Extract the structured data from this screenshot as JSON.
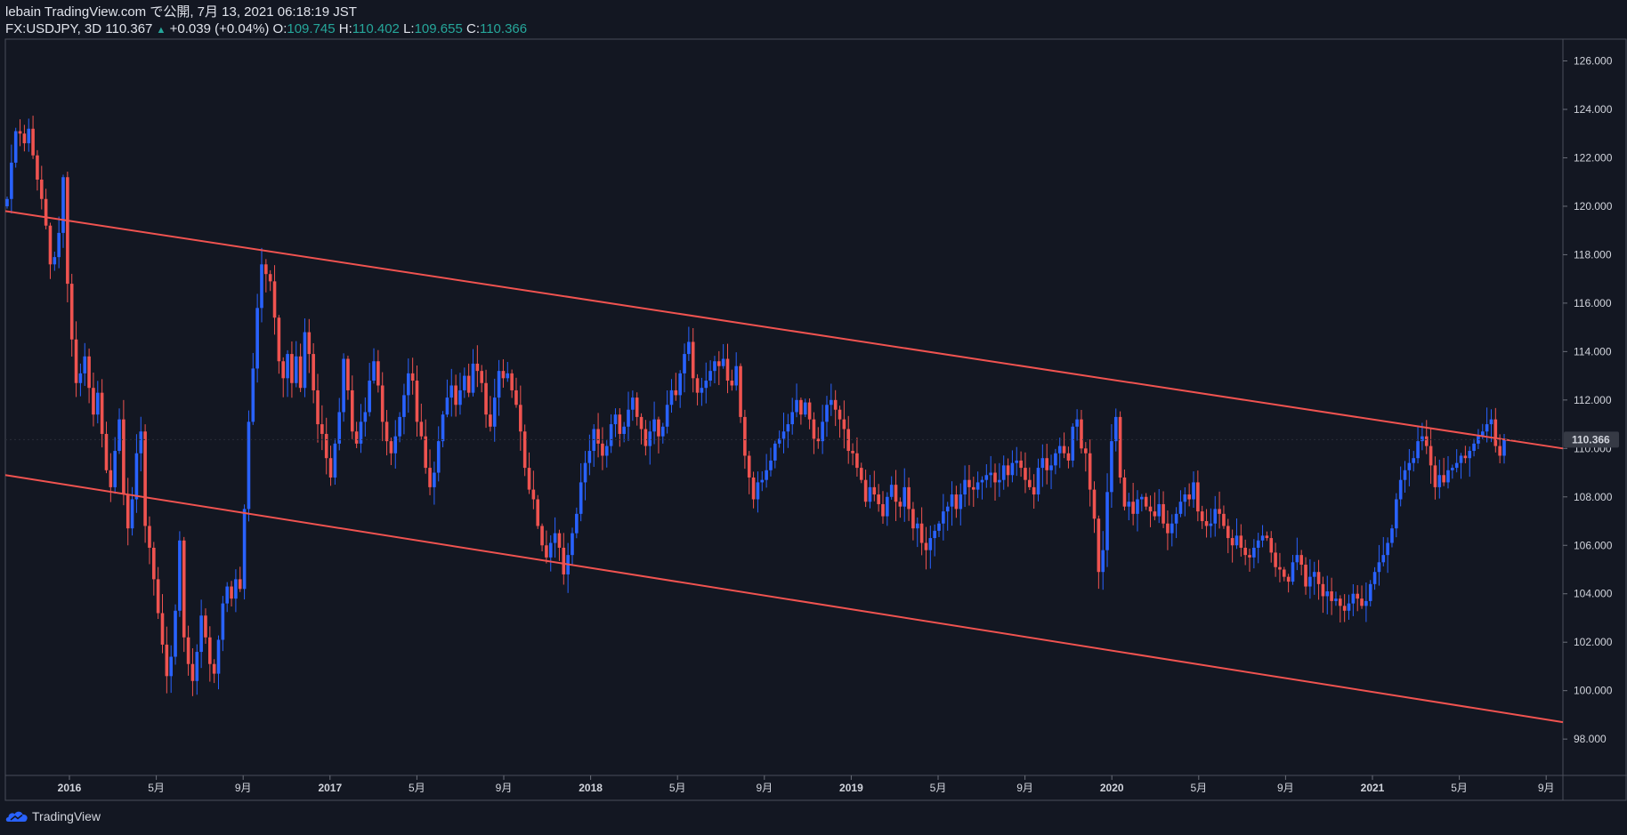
{
  "header": {
    "line1": "lebain TradingView.com で公開, 7月 13, 2021 06:18:19 JST",
    "symbol": "FX:USDJPY, 3D",
    "last": "110.367",
    "arrow": "▲",
    "change": "+0.039 (+0.04%)",
    "o_label": "O:",
    "o": "109.745",
    "h_label": "H:",
    "h": "110.402",
    "l_label": "L:",
    "l": "109.655",
    "c_label": "C:",
    "c": "110.366"
  },
  "footer": {
    "brand": "TradingView"
  },
  "colors": {
    "background": "#131722",
    "up": "#2962ff",
    "down": "#ef5350",
    "channel": "#f05350",
    "axis_text": "#d1d4dc",
    "price_tag_bg": "#363a45"
  },
  "chart_data": {
    "type": "candlestick",
    "symbol": "FX:USDJPY",
    "interval": "3D",
    "x_tick_labels": [
      "2016",
      "5月",
      "9月",
      "2017",
      "5月",
      "9月",
      "2018",
      "5月",
      "9月",
      "2019",
      "5月",
      "9月",
      "2020",
      "5月",
      "9月",
      "2021",
      "5月",
      "9月"
    ],
    "y_tick_labels": [
      "98.000",
      "100.000",
      "102.000",
      "104.000",
      "106.000",
      "108.000",
      "110.000",
      "112.000",
      "114.000",
      "116.000",
      "118.000",
      "120.000",
      "122.000",
      "124.000",
      "126.000"
    ],
    "ylim": [
      96.5,
      126.9
    ],
    "last_price_label": "110.366",
    "last_price": 110.366,
    "closes": [
      120.3,
      121.8,
      123.1,
      123.0,
      122.6,
      123.2,
      122.1,
      121.1,
      120.3,
      119.2,
      117.6,
      117.9,
      118.9,
      121.2,
      116.8,
      114.5,
      112.7,
      113.1,
      113.8,
      112.5,
      111.4,
      112.3,
      110.6,
      109.1,
      108.4,
      109.9,
      111.2,
      108.1,
      106.7,
      107.9,
      109.8,
      110.7,
      106.8,
      105.9,
      104.6,
      103.2,
      101.9,
      100.6,
      101.4,
      103.3,
      106.2,
      102.2,
      101.1,
      100.4,
      101.6,
      103.1,
      102.2,
      101.1,
      100.7,
      102.1,
      103.6,
      104.3,
      103.8,
      104.6,
      104.2,
      107.5,
      111.1,
      113.3,
      115.8,
      117.6,
      117.2,
      116.9,
      115.4,
      113.6,
      112.9,
      113.9,
      112.7,
      113.8,
      112.5,
      114.8,
      113.9,
      112.4,
      111.0,
      110.6,
      109.6,
      108.8,
      110.2,
      111.5,
      113.7,
      112.4,
      110.7,
      110.2,
      111.1,
      111.5,
      112.8,
      113.6,
      112.6,
      111.1,
      110.3,
      109.8,
      110.5,
      111.3,
      112.2,
      113.1,
      112.8,
      111.1,
      110.5,
      109.2,
      108.4,
      109.0,
      110.3,
      111.4,
      112.1,
      112.6,
      111.8,
      112.4,
      113.0,
      112.3,
      113.5,
      113.2,
      112.7,
      111.4,
      110.9,
      112.1,
      113.2,
      112.9,
      113.1,
      112.4,
      111.8,
      110.7,
      109.2,
      108.3,
      107.9,
      106.8,
      106.0,
      105.5,
      106.1,
      106.5,
      105.9,
      104.8,
      105.6,
      106.5,
      107.3,
      108.6,
      109.4,
      109.9,
      110.8,
      110.2,
      109.7,
      110.1,
      111.0,
      111.4,
      110.6,
      110.9,
      111.6,
      112.1,
      111.3,
      110.8,
      110.1,
      110.7,
      111.2,
      110.5,
      110.9,
      111.8,
      112.4,
      112.2,
      113.1,
      113.9,
      114.4,
      112.9,
      112.3,
      112.5,
      112.8,
      113.2,
      113.6,
      113.4,
      113.7,
      112.8,
      112.6,
      113.4,
      111.3,
      109.7,
      108.8,
      107.9,
      108.6,
      108.7,
      109.1,
      109.5,
      110.2,
      110.4,
      110.7,
      111.0,
      111.5,
      112.0,
      111.4,
      111.9,
      111.2,
      110.4,
      110.3,
      111.1,
      111.8,
      112.0,
      111.6,
      111.2,
      110.8,
      109.9,
      109.8,
      109.2,
      108.7,
      107.8,
      108.4,
      108.1,
      107.7,
      107.2,
      108.0,
      108.5,
      107.8,
      107.6,
      108.4,
      107.5,
      106.7,
      106.9,
      106.1,
      105.8,
      106.3,
      106.6,
      106.9,
      107.4,
      107.6,
      108.1,
      107.5,
      108.1,
      108.7,
      108.4,
      108.3,
      108.6,
      108.7,
      108.9,
      109.0,
      108.6,
      108.7,
      109.3,
      108.9,
      109.4,
      109.5,
      109.2,
      108.7,
      108.4,
      108.1,
      109.2,
      109.6,
      109.1,
      109.3,
      109.8,
      110.1,
      109.8,
      109.5,
      110.9,
      111.2,
      110.0,
      109.8,
      108.3,
      107.1,
      104.9,
      105.8,
      108.2,
      110.3,
      111.3,
      108.8,
      107.6,
      107.8,
      107.3,
      107.9,
      108.0,
      107.6,
      107.4,
      107.2,
      107.7,
      106.9,
      106.5,
      106.9,
      107.3,
      107.8,
      108.1,
      107.9,
      108.6,
      107.4,
      107.0,
      106.8,
      106.9,
      107.5,
      107.3,
      106.8,
      106.3,
      106.0,
      106.4,
      105.9,
      105.6,
      105.5,
      105.9,
      106.2,
      106.4,
      106.3,
      105.7,
      105.1,
      105.0,
      104.7,
      104.5,
      105.3,
      105.6,
      105.2,
      104.3,
      104.7,
      104.9,
      104.4,
      103.9,
      104.1,
      103.7,
      103.8,
      103.5,
      103.3,
      103.6,
      104.0,
      103.8,
      103.5,
      103.7,
      104.4,
      104.9,
      105.3,
      105.6,
      106.1,
      106.7,
      107.9,
      108.7,
      109.1,
      109.4,
      109.6,
      110.3,
      110.5,
      110.1,
      109.3,
      108.4,
      108.9,
      108.6,
      109.1,
      109.2,
      109.4,
      109.7,
      109.6,
      109.9,
      110.2,
      110.5,
      110.7,
      111.0,
      111.2,
      110.1,
      109.7,
      110.366
    ]
  }
}
